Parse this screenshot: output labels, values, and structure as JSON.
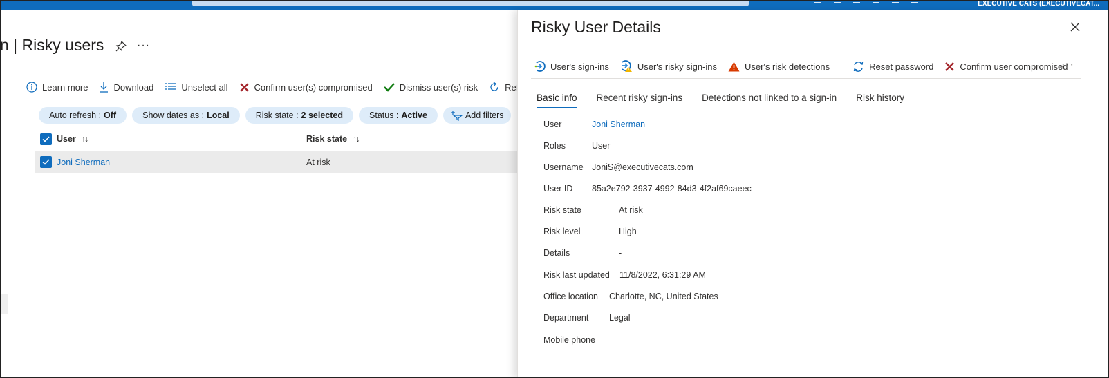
{
  "topbar": {
    "tenant": "EXECUTIVE CATS (EXECUTIVECAT..."
  },
  "page": {
    "title": "n | Risky users",
    "more": "···"
  },
  "commands": [
    {
      "label": "Learn more",
      "icon": "info-icon"
    },
    {
      "label": "Download",
      "icon": "download-icon"
    },
    {
      "label": "Unselect all",
      "icon": "list-icon"
    },
    {
      "label": "Confirm user(s) compromised",
      "icon": "x-icon"
    },
    {
      "label": "Dismiss user(s) risk",
      "icon": "check-icon"
    },
    {
      "label": "Refres",
      "icon": "refresh-icon"
    }
  ],
  "filters": [
    {
      "label": "Auto refresh :",
      "value": "Off"
    },
    {
      "label": "Show dates as :",
      "value": "Local"
    },
    {
      "label": "Risk state :",
      "value": "2 selected"
    },
    {
      "label": "Status :",
      "value": "Active"
    }
  ],
  "add_filter": "Add filters",
  "grid": {
    "columns": {
      "user": "User",
      "risk_state": "Risk state",
      "sort": "↑↓"
    },
    "rows": [
      {
        "user": "Joni Sherman",
        "risk_state": "At risk"
      }
    ]
  },
  "panel": {
    "title": "Risky User Details",
    "toolbar": [
      {
        "label": "User's sign-ins",
        "icon": "sign-in-icon"
      },
      {
        "label": "User's risky sign-ins",
        "icon": "risky-sign-in-icon"
      },
      {
        "label": "User's risk detections",
        "icon": "warning-icon"
      },
      {
        "label": "Reset password",
        "icon": "reset-icon"
      },
      {
        "label": "Confirm user compromised",
        "icon": "x-icon"
      }
    ],
    "more": "···",
    "tabs": [
      "Basic info",
      "Recent risky sign-ins",
      "Detections not linked to a sign-in",
      "Risk history"
    ],
    "fields": [
      {
        "label": "User",
        "value": "Joni Sherman"
      },
      {
        "label": "Roles",
        "value": "User"
      },
      {
        "label": "Username",
        "value": "JoniS@executivecats.com"
      },
      {
        "label": "User ID",
        "value": "85a2e792-3937-4992-84d3-4f2af69caeec"
      },
      {
        "label": "Risk state",
        "value": "At risk"
      },
      {
        "label": "Risk level",
        "value": "High"
      },
      {
        "label": "Details",
        "value": "-"
      },
      {
        "label": "Risk last updated",
        "value": "11/8/2022, 6:31:29 AM"
      },
      {
        "label": "Office location",
        "value": "Charlotte, NC, United States"
      },
      {
        "label": "Department",
        "value": "Legal"
      },
      {
        "label": "Mobile phone",
        "value": ""
      }
    ]
  },
  "colors": {
    "accent": "#0f6cbd",
    "danger": "#a4262c",
    "success": "#107c10",
    "warning": "#d83b01"
  }
}
